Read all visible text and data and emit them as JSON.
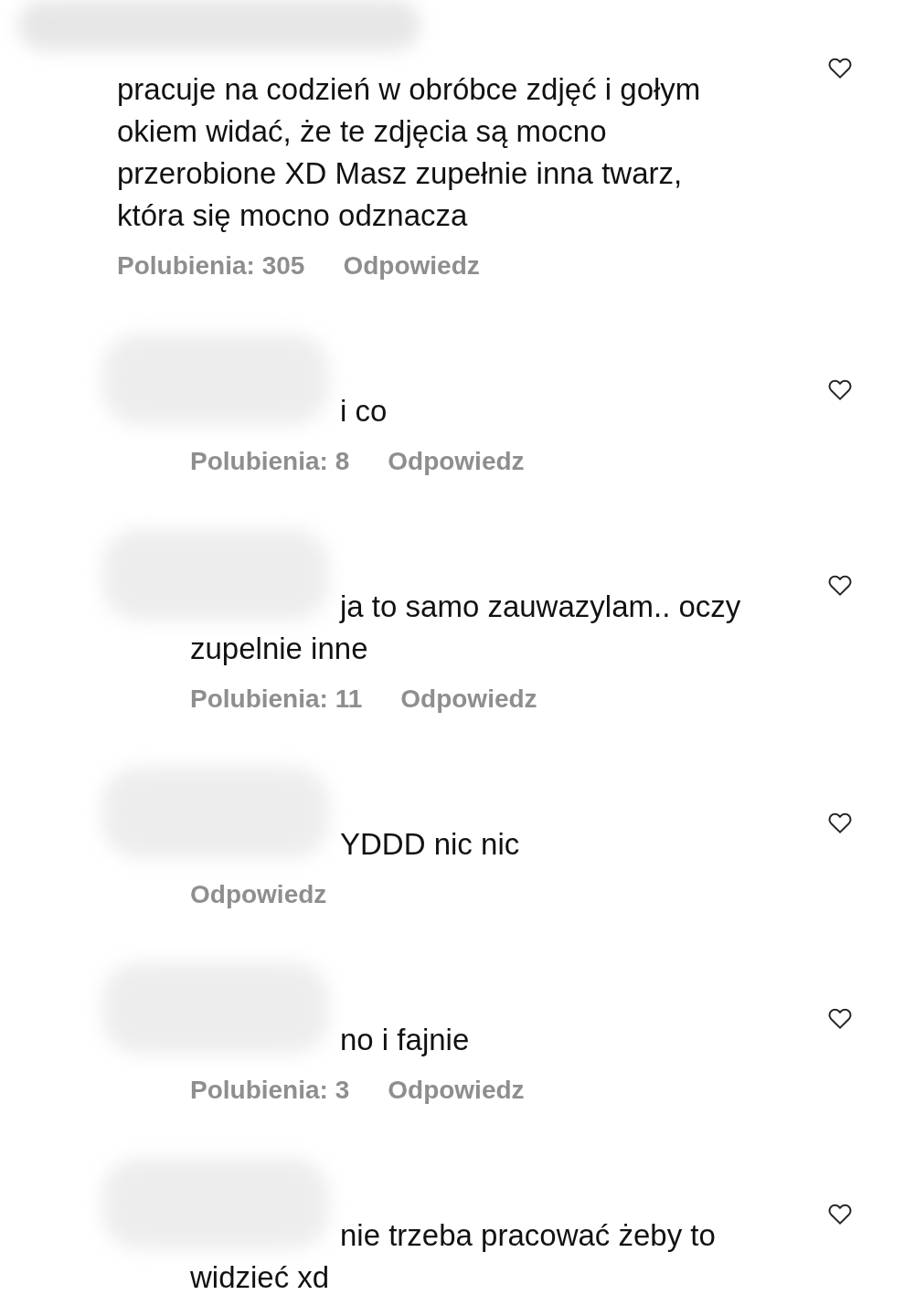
{
  "comments": [
    {
      "text": "pracuje na codzień w obróbce zdjęć i gołym okiem widać, że te zdjęcia są mocno przerobione XD Masz zupełnie inna twarz, która się mocno odznacza",
      "likes": "Polubienia: 305",
      "reply": "Odpowiedz",
      "liked": false,
      "children": [
        {
          "text": "i co",
          "likes": "Polubienia: 8",
          "reply": "Odpowiedz",
          "liked": false
        },
        {
          "text": "ja to samo zauwazylam.. oczy zupelnie inne",
          "likes": "Polubienia: 11",
          "reply": "Odpowiedz",
          "liked": false
        },
        {
          "text": "YDDD nic nic",
          "reply": "Odpowiedz",
          "liked": false
        },
        {
          "text": "no i fajnie",
          "likes": "Polubienia: 3",
          "reply": "Odpowiedz",
          "liked": false
        },
        {
          "text": "nie trzeba pracować żeby to widzieć xd",
          "liked": false
        }
      ]
    }
  ]
}
